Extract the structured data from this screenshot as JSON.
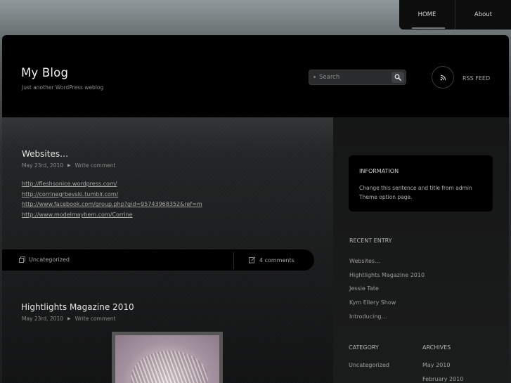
{
  "nav": {
    "items": [
      {
        "label": "HOME"
      },
      {
        "label": "About"
      }
    ]
  },
  "header": {
    "title": "My Blog",
    "tagline": "Just another WordPress weblog",
    "search_placeholder": "Search",
    "rss_label": "RSS FEED"
  },
  "posts": [
    {
      "title": "Websites…",
      "date": "May 23rd, 2010",
      "comment_link": "Write comment",
      "links": [
        "http://fleshsonice.wordpress.com/",
        "http://corrinegrbevski.tumblr.com/",
        "http://www.facebook.com/group.php?gid=95743968352&ref=m",
        "http://www.modelmayhem.com/Corrine"
      ],
      "category": "Uncategorized",
      "comments_count": "4 comments"
    },
    {
      "title": "Hightlights Magazine 2010",
      "date": "May 23rd, 2010",
      "comment_link": "Write comment"
    }
  ],
  "sidebar": {
    "info": {
      "title": "INFORMATION",
      "text": "Change this sentence and title from admin Theme option page."
    },
    "recent": {
      "heading": "RECENT ENTRY",
      "items": [
        "Websites…",
        "Hightlights Magazine 2010",
        "Jessie Tate",
        "Kym Ellery Show",
        "Introducing…"
      ]
    },
    "category": {
      "heading": "CATEGORY",
      "items": [
        "Uncategorized"
      ]
    },
    "archives": {
      "heading": "ARCHIVES",
      "items": [
        "May 2010",
        "February 2010"
      ]
    }
  }
}
